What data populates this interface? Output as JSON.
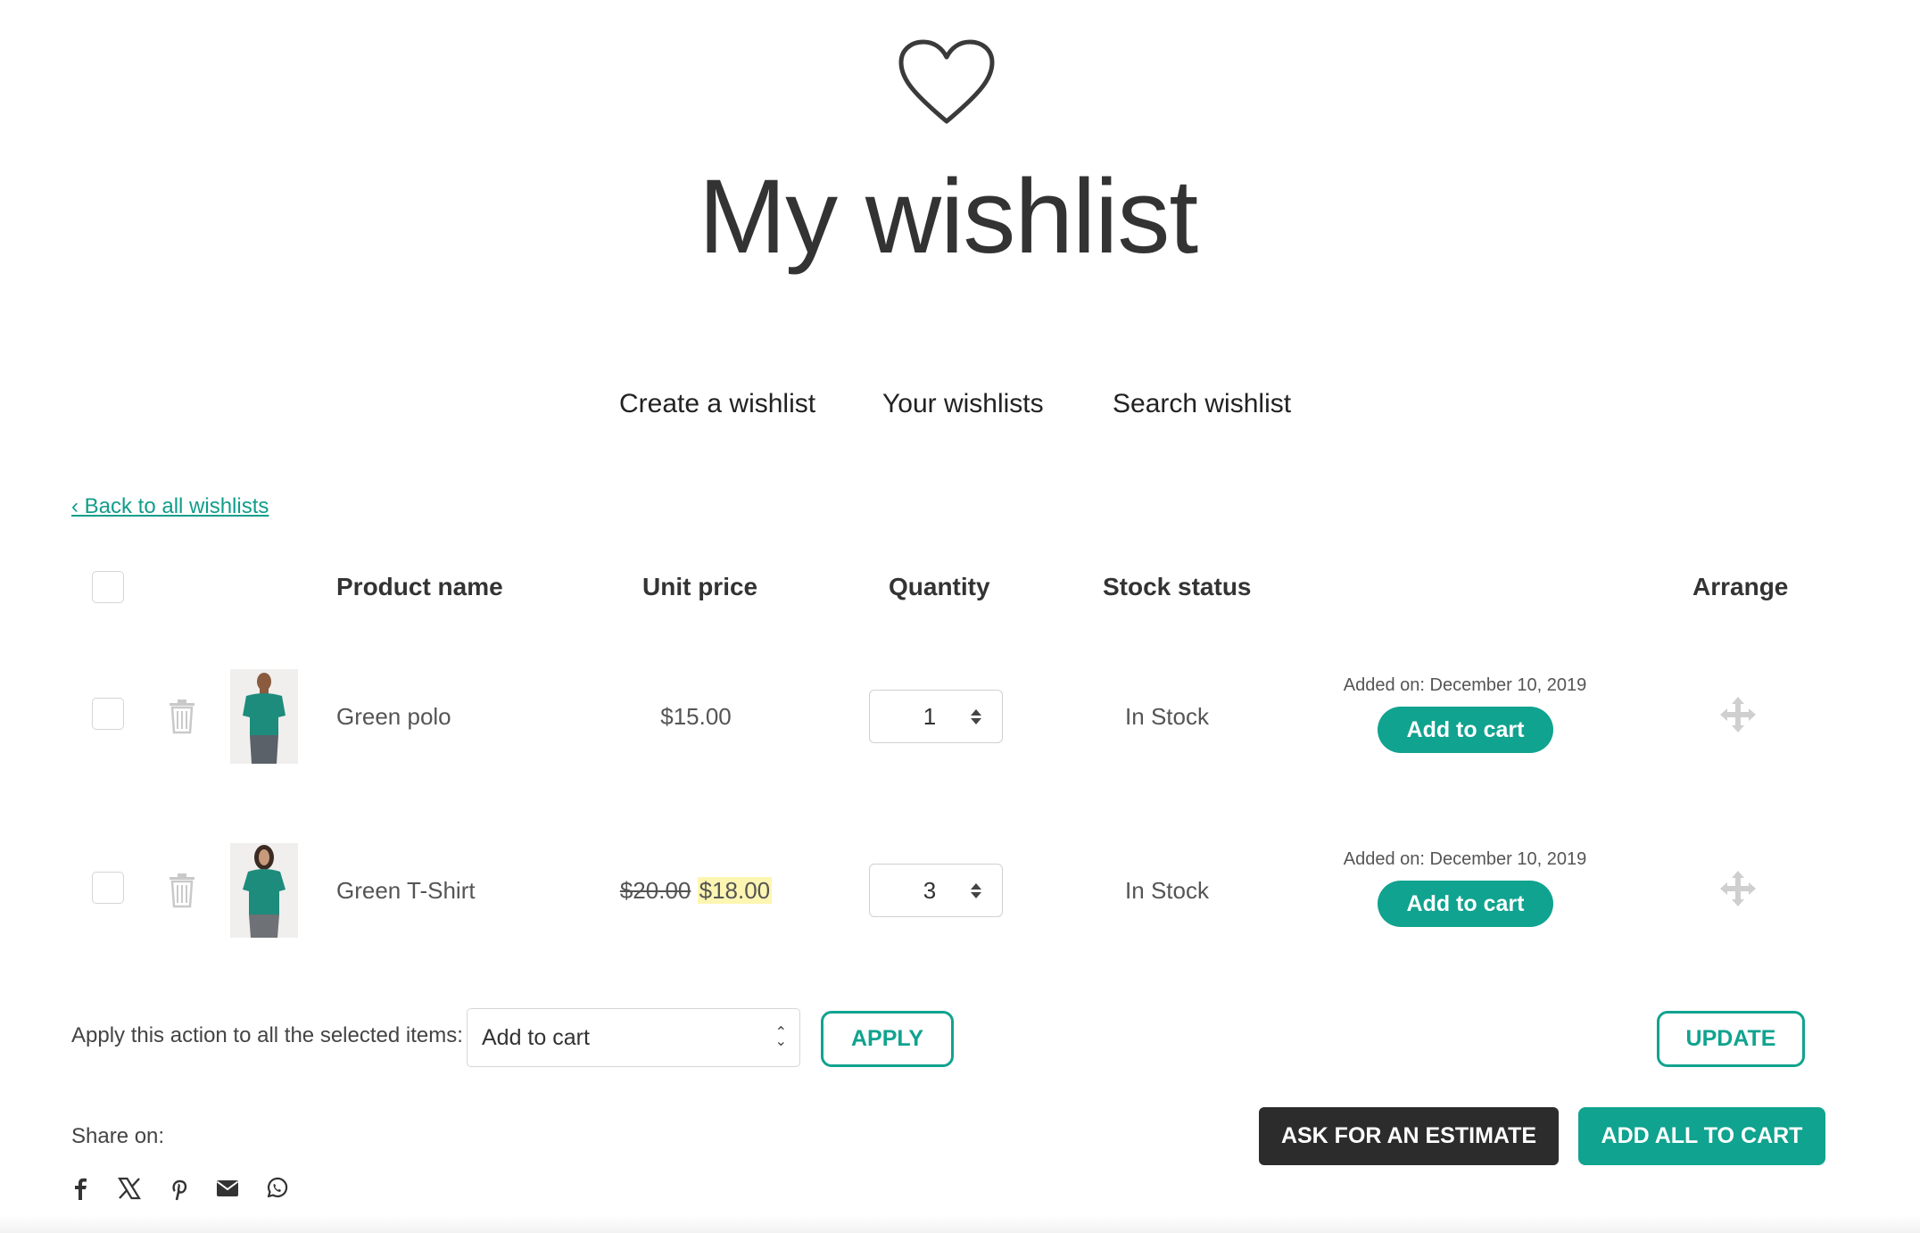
{
  "page": {
    "title": "My wishlist",
    "icon": "heart-icon"
  },
  "nav": {
    "create": "Create a wishlist",
    "yours": "Your wishlists",
    "search": "Search wishlist"
  },
  "back_link": "‹ Back to all wishlists",
  "table": {
    "headers": {
      "product_name": "Product name",
      "unit_price": "Unit price",
      "quantity": "Quantity",
      "stock_status": "Stock status",
      "arrange": "Arrange"
    },
    "rows": [
      {
        "name": "Green polo",
        "price": "$15.00",
        "old_price": "",
        "quantity": "1",
        "stock": "In Stock",
        "added": "Added on: December 10, 2019",
        "cart_label": "Add to cart",
        "image": "man-in-green-polo"
      },
      {
        "name": "Green T-Shirt",
        "price": "$18.00",
        "old_price": "$20.00",
        "quantity": "3",
        "stock": "In Stock",
        "added": "Added on: December 10, 2019",
        "cart_label": "Add to cart",
        "image": "woman-in-green-tshirt"
      }
    ]
  },
  "bulk": {
    "label": "Apply this action to all the selected items:",
    "selected_action": "Add to cart",
    "apply_label": "APPLY",
    "update_label": "UPDATE"
  },
  "share": {
    "label": "Share on:",
    "networks": [
      "facebook-icon",
      "x-icon",
      "pinterest-icon",
      "email-icon",
      "whatsapp-icon"
    ]
  },
  "actions": {
    "estimate_label": "ASK FOR AN ESTIMATE",
    "add_all_label": "ADD ALL TO CART"
  },
  "colors": {
    "accent": "#10a38f",
    "dark_button": "#2c2c2c",
    "sale_highlight": "#fdf6b2"
  }
}
